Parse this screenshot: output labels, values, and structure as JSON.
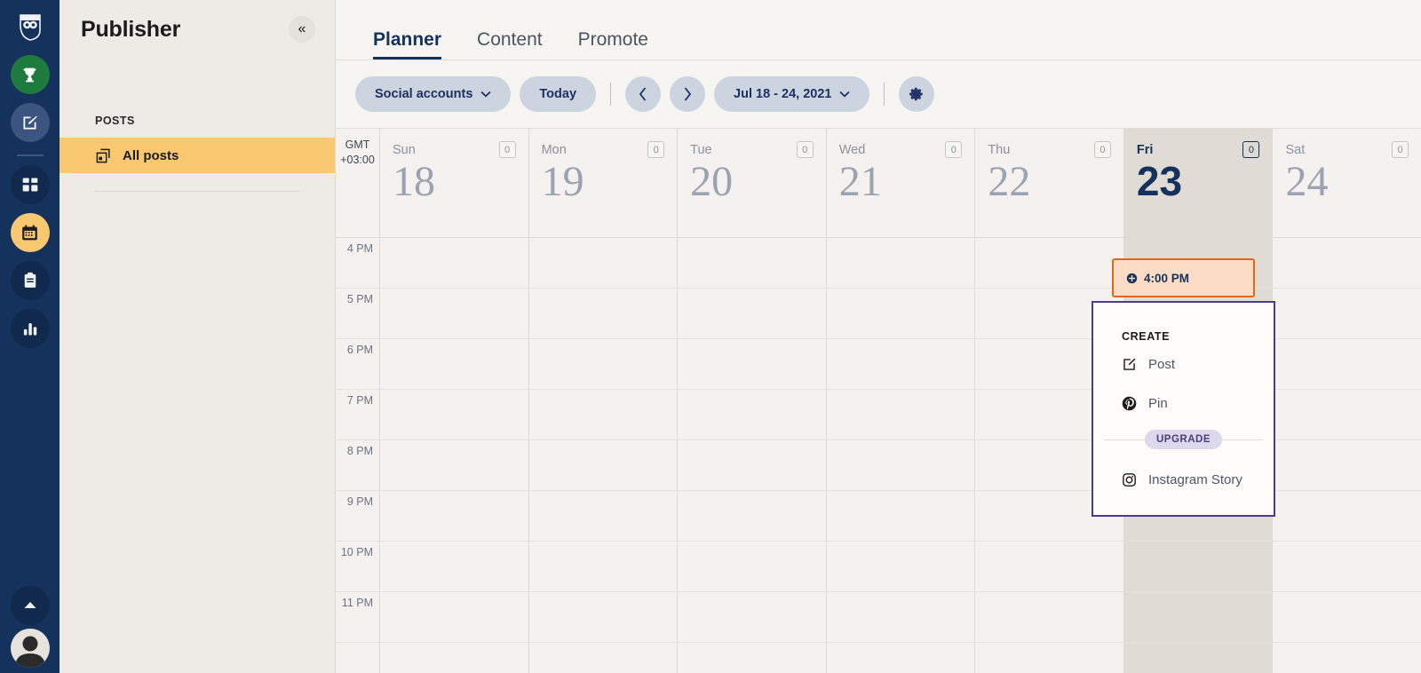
{
  "rail": {
    "logo": "hootsuite-owl-logo",
    "items": [
      {
        "name": "rewards",
        "icon": "trophy-icon"
      },
      {
        "name": "compose",
        "icon": "compose-pencil-icon"
      },
      {
        "name": "streams",
        "icon": "grid-squares-icon"
      },
      {
        "name": "planner",
        "icon": "calendar-icon"
      },
      {
        "name": "inbox",
        "icon": "clipboard-icon"
      },
      {
        "name": "analytics",
        "icon": "bar-chart-icon"
      }
    ],
    "collapse_up": "chevron-up-icon",
    "avatar": "user-avatar-icon"
  },
  "sidebar": {
    "title": "Publisher",
    "collapse_label": "«",
    "section_label": "POSTS",
    "items": [
      {
        "label": "All posts",
        "icon": "stacked-posts-icon",
        "active": true
      }
    ]
  },
  "tabs": [
    {
      "label": "Planner",
      "active": true
    },
    {
      "label": "Content",
      "active": false
    },
    {
      "label": "Promote",
      "active": false
    }
  ],
  "toolbar": {
    "social_accounts_label": "Social accounts",
    "today_label": "Today",
    "prev_label": "‹",
    "next_label": "›",
    "date_range_label": "Jul 18 - 24, 2021",
    "settings_icon": "gear-icon",
    "caret": "⌄"
  },
  "calendar": {
    "timezone_line1": "GMT",
    "timezone_line2": "+03:00",
    "days": [
      {
        "name": "Sun",
        "num": "18",
        "count": "0",
        "today": false
      },
      {
        "name": "Mon",
        "num": "19",
        "count": "0",
        "today": false
      },
      {
        "name": "Tue",
        "num": "20",
        "count": "0",
        "today": false
      },
      {
        "name": "Wed",
        "num": "21",
        "count": "0",
        "today": false
      },
      {
        "name": "Thu",
        "num": "22",
        "count": "0",
        "today": false
      },
      {
        "name": "Fri",
        "num": "23",
        "count": "0",
        "today": true
      },
      {
        "name": "Sat",
        "num": "24",
        "count": "0",
        "today": false
      }
    ],
    "time_slots": [
      "4 PM",
      "5 PM",
      "6 PM",
      "7 PM",
      "8 PM",
      "9 PM",
      "10 PM",
      "11 PM"
    ],
    "event": {
      "time_label": "4:00 PM",
      "icon": "plus-circle-icon",
      "day": "Fri",
      "border_color": "#e2661a",
      "fill_color": "#fcdcc4"
    }
  },
  "popup": {
    "title": "CREATE",
    "items": [
      {
        "label": "Post",
        "icon": "compose-pencil-icon"
      },
      {
        "label": "Pin",
        "icon": "pinterest-icon"
      }
    ],
    "upgrade_label": "UPGRADE",
    "upgrade_items": [
      {
        "label": "Instagram Story",
        "icon": "instagram-icon"
      }
    ],
    "border_color": "#4b3c8f"
  },
  "colors": {
    "rail_bg": "#14325c",
    "sidebar_bg": "#eeebe7",
    "accent_yellow": "#fac870",
    "pill_bg": "#ccd4e0",
    "navy_text": "#1c3064",
    "today_col": "#e0dcd5",
    "grid_bg": "#f4f1ee"
  }
}
